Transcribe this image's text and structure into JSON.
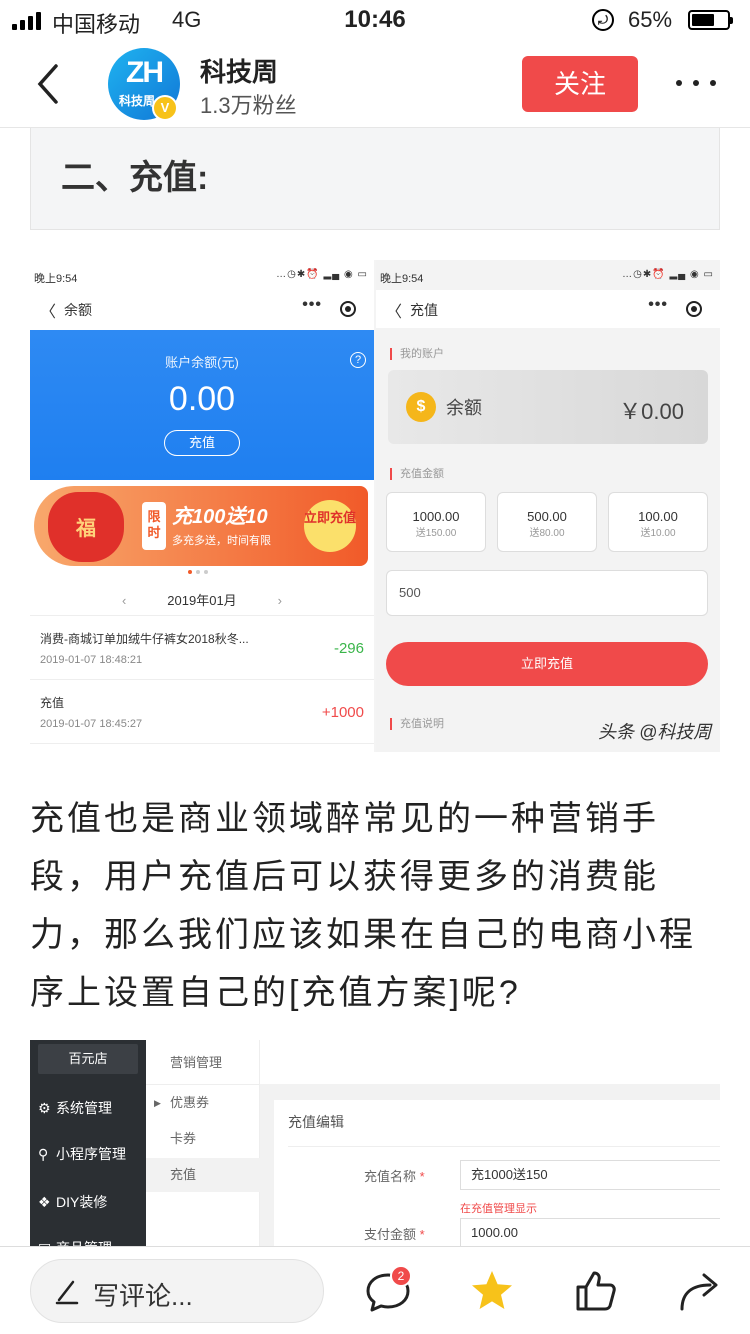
{
  "status_bar": {
    "carrier": "中国移动",
    "network": "4G",
    "time": "10:46",
    "battery_pct": "65%",
    "battery_level": 0.65
  },
  "header": {
    "avatar_text": "ZH",
    "avatar_sub": "科技周",
    "verified_mark": "V",
    "account_name": "科技周",
    "fans": "1.3万粉丝",
    "follow_label": "关注"
  },
  "article": {
    "section_title": "二、充值:",
    "paragraph": "充值也是商业领域醉常见的一种营销手段，用户充值后可以获得更多的消费能力，那么我们应该如果在自己的电商小程序上设置自己的[充值方案]呢?"
  },
  "screenshot_balance": {
    "status_time": "晚上9:54",
    "nav_title": "余额",
    "balance_label": "账户余额(元)",
    "balance_amount": "0.00",
    "recharge_button": "充值",
    "promo_limited": "限时",
    "promo_main": "充100送10",
    "promo_sub": "多充多送，时间有限",
    "promo_button": "立即充值",
    "promo_bag_text": "福",
    "month": "2019年01月",
    "transactions": [
      {
        "name": "消费-商城订单加绒牛仔裤女2018秋冬...",
        "time": "2019-01-07 18:48:21",
        "amount": "-296",
        "color": "#3ab54a"
      },
      {
        "name": "充值",
        "time": "2019-01-07 18:45:27",
        "amount": "+1000",
        "color": "#f04a4a"
      }
    ]
  },
  "screenshot_recharge": {
    "status_time": "晚上9:54",
    "nav_title": "充值",
    "my_account_label": "我的账户",
    "balance_label": "余额",
    "balance_amount": "￥0.00",
    "coin_symbol": "$",
    "amount_label": "充值金额",
    "options": [
      {
        "amount": "1000.00",
        "bonus": "送150.00"
      },
      {
        "amount": "500.00",
        "bonus": "送80.00"
      },
      {
        "amount": "100.00",
        "bonus": "送10.00"
      }
    ],
    "input_value": "500",
    "submit_label": "立即充值",
    "desc_label": "充值说明",
    "watermark": "头条 @科技周"
  },
  "screenshot_admin": {
    "shop_name": "百元店",
    "sidebar_items": [
      "系统管理",
      "小程序管理",
      "DIY装修",
      "商品管理"
    ],
    "submenu_header": "营销管理",
    "submenu_items": [
      "优惠券",
      "卡券",
      "充值"
    ],
    "card_title": "充值编辑",
    "field_name_label": "充值名称",
    "field_name_value": "充1000送150",
    "field_name_hint": "在充值管理显示",
    "field_pay_label": "支付金额",
    "field_pay_value": "1000.00",
    "required_mark": "*"
  },
  "bottom_bar": {
    "comment_placeholder": "写评论...",
    "comment_count": "2"
  },
  "colors": {
    "accent_red": "#f04a4a",
    "favorite_yellow": "#f7c21a",
    "balance_blue": "#2e8af3"
  }
}
